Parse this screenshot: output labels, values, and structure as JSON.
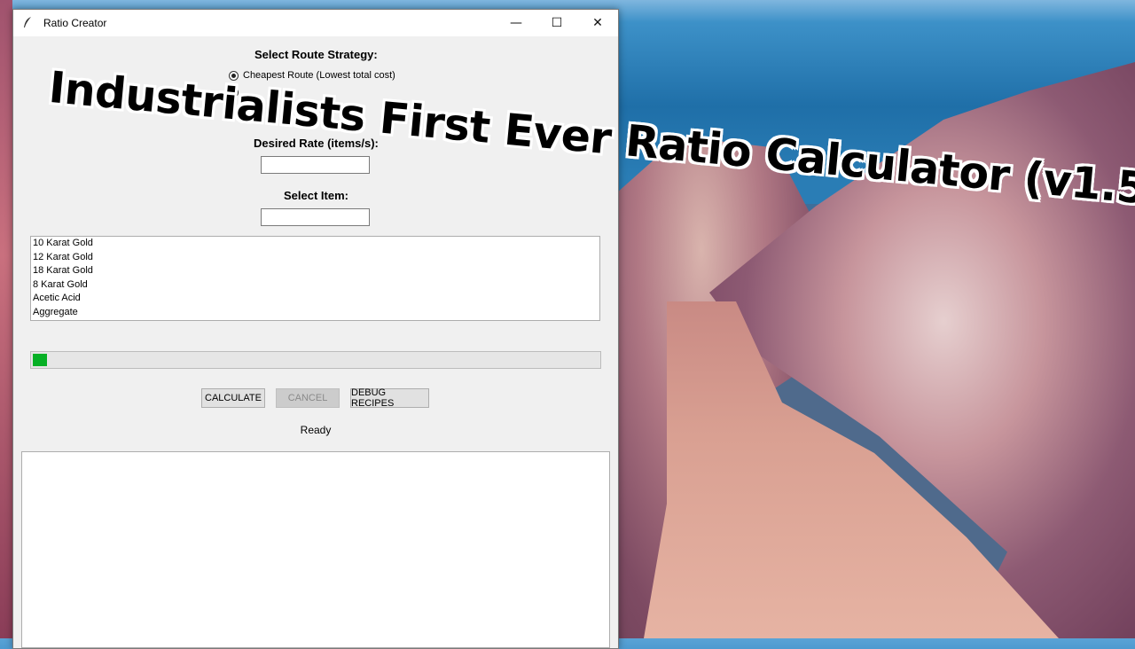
{
  "overlay": {
    "headline": "Industrialists First Ever Ratio Calculator (v1.5)"
  },
  "window": {
    "title": "Ratio Creator",
    "icon": "feather-icon",
    "controls": {
      "minimize": "—",
      "maximize": "☐",
      "close": "✕"
    }
  },
  "route": {
    "heading": "Select Route Strategy:",
    "options": [
      {
        "label": "Cheapest Route (Lowest total cost)",
        "selected": true
      },
      {
        "label": "",
        "selected": false
      },
      {
        "label": "",
        "selected": false
      }
    ]
  },
  "rate": {
    "heading": "Desired Rate (items/s):",
    "value": ""
  },
  "item": {
    "heading": "Select Item:",
    "value": ""
  },
  "items_list": [
    "10 Karat Gold",
    "12 Karat Gold",
    "18 Karat Gold",
    "8 Karat Gold",
    "Acetic Acid",
    "Aggregate"
  ],
  "progress": {
    "fraction": 0.025,
    "color": "#06b025"
  },
  "buttons": {
    "calculate": "CALCULATE",
    "cancel": "CANCEL",
    "debug": "DEBUG RECIPES"
  },
  "status": "Ready"
}
